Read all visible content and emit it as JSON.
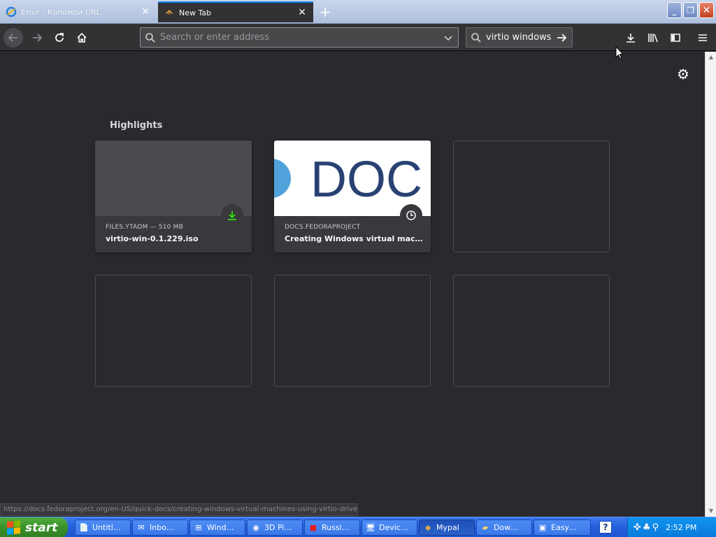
{
  "tabs": [
    {
      "title": "Error - Копомой URL",
      "icon": "ie-error-icon",
      "active": false
    },
    {
      "title": "New Tab",
      "icon": "mypal-icon",
      "active": true
    }
  ],
  "navbar": {
    "url_placeholder": "Search or enter address",
    "url_value": "",
    "search_value": "virtio windows"
  },
  "content": {
    "section_title": "Highlights",
    "cards": [
      {
        "meta": "FILES.YTADM — 510 MB",
        "title": "virtio-win-0.1.229.iso",
        "badge": "download-icon"
      },
      {
        "meta": "DOCS.FEDORAPROJECT",
        "title": "Creating Windows virtual machi…",
        "badge": "clock-icon",
        "thumb_text": "DOC"
      }
    ],
    "status_url": "https://docs.fedoraproject.org/en-US/quick-docs/creating-windows-virtual-machines-using-virtio-drivers/"
  },
  "taskbar": {
    "start_label": "start",
    "tasks": [
      {
        "label": "Untitl…",
        "icon": "notepad-icon"
      },
      {
        "label": "Inbo…",
        "icon": "mail-icon"
      },
      {
        "label": "Wind…",
        "icon": "windows-icon"
      },
      {
        "label": "3D Pi…",
        "icon": "pinball-icon"
      },
      {
        "label": "Russi…",
        "icon": "app-icon"
      },
      {
        "label": "Devic…",
        "icon": "device-manager-icon"
      },
      {
        "label": "Mypal",
        "icon": "mypal-icon",
        "active": true
      },
      {
        "label": "Dow…",
        "icon": "folder-icon"
      },
      {
        "label": "Easy…",
        "icon": "app-icon"
      }
    ],
    "clock": "2:52 PM"
  },
  "colors": {
    "accent": "#0a84ff",
    "content_bg": "#2a2a2e",
    "toolbar_bg": "#323234",
    "download_green": "#30e60b",
    "docs_blue": "#294172"
  }
}
